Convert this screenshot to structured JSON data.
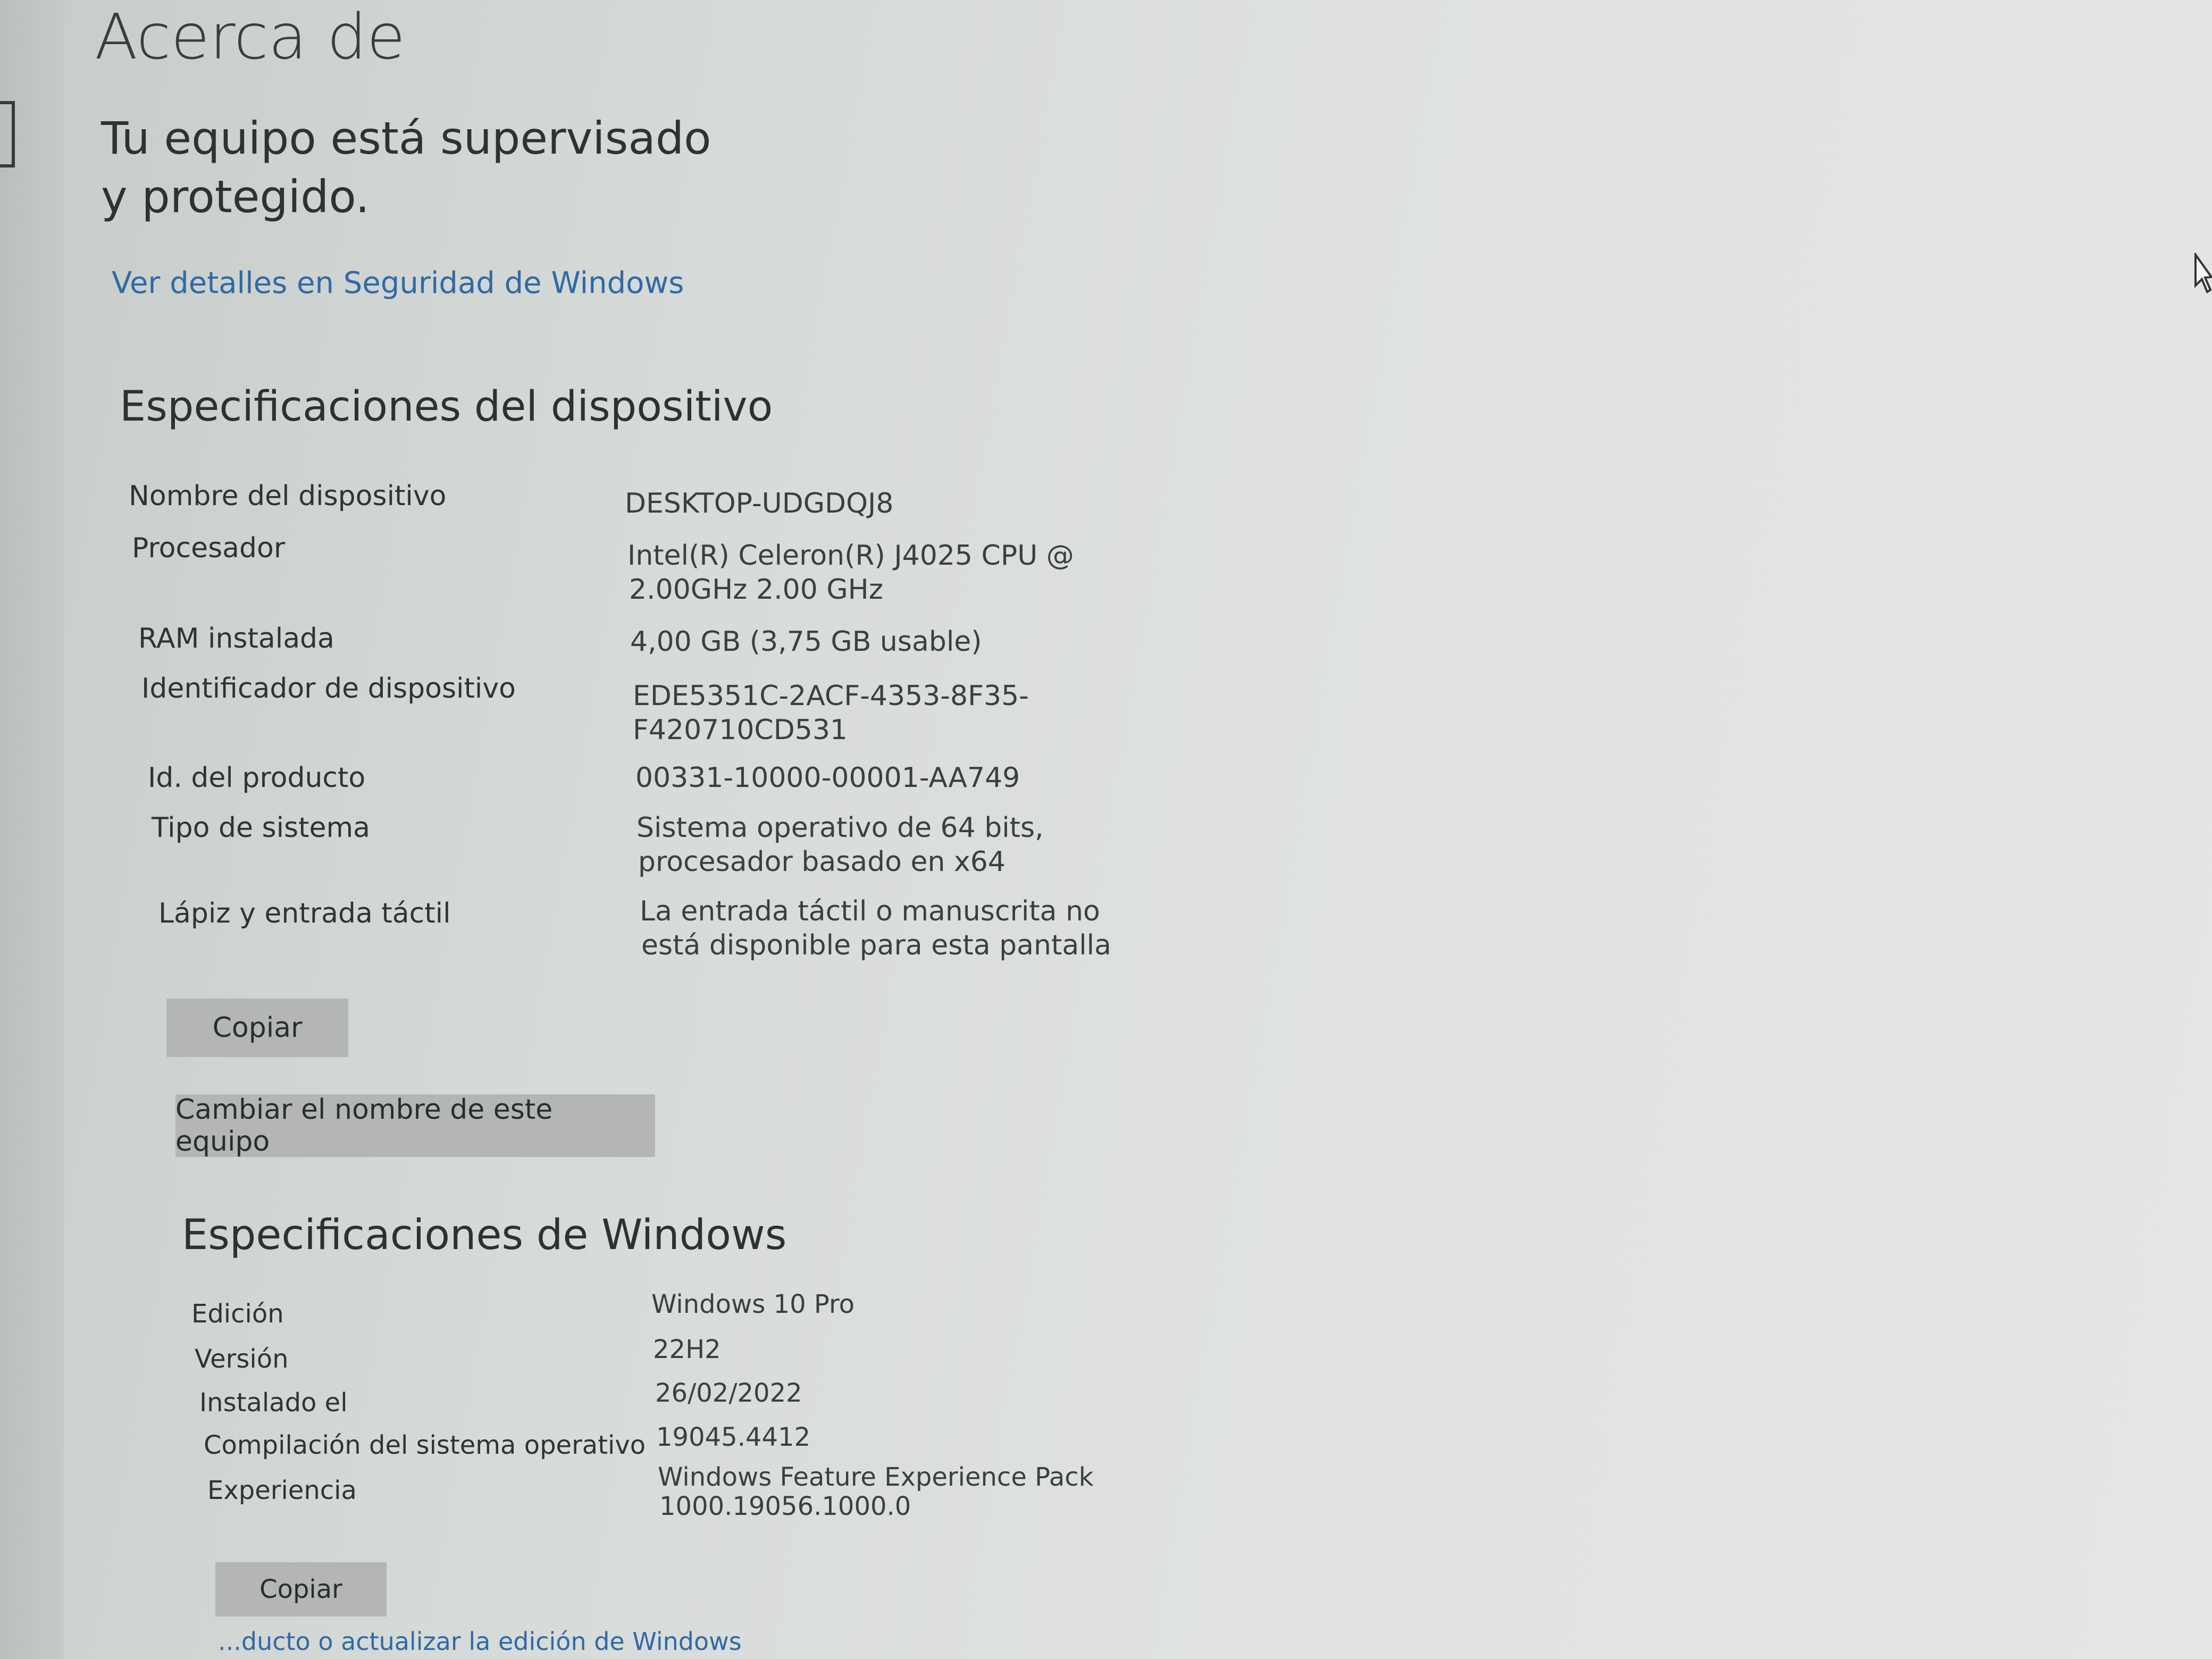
{
  "page": {
    "title": "Acerca de",
    "protection_status": "Tu equipo está supervisado y protegido.",
    "security_link": "Ver detalles en Seguridad de Windows"
  },
  "device_specs": {
    "heading": "Especificaciones del dispositivo",
    "rows": [
      {
        "label": "Nombre del dispositivo",
        "value": "DESKTOP-UDGDQJ8"
      },
      {
        "label": "Procesador",
        "value": "Intel(R) Celeron(R) J4025 CPU @",
        "value2": "2.00GHz   2.00 GHz"
      },
      {
        "label": "RAM instalada",
        "value": "4,00 GB (3,75 GB usable)"
      },
      {
        "label": "Identificador de dispositivo",
        "value": "EDE5351C-2ACF-4353-8F35-",
        "value2": "F420710CD531"
      },
      {
        "label": "Id. del producto",
        "value": "00331-10000-00001-AA749"
      },
      {
        "label": "Tipo de sistema",
        "value": "Sistema operativo de 64 bits,",
        "value2": "procesador basado en x64"
      },
      {
        "label": "Lápiz y entrada táctil",
        "value": "La entrada táctil o manuscrita no",
        "value2": "está disponible para esta pantalla"
      }
    ],
    "copy_button": "Copiar",
    "rename_button": "Cambiar el nombre de este equipo"
  },
  "windows_specs": {
    "heading": "Especificaciones de Windows",
    "rows": [
      {
        "label": "Edición",
        "value": "Windows 10 Pro"
      },
      {
        "label": "Versión",
        "value": "22H2"
      },
      {
        "label": "Instalado el",
        "value": "26/02/2022"
      },
      {
        "label": "Compilación del sistema operativo",
        "value": "19045.4412"
      },
      {
        "label": "Experiencia",
        "value": "Windows Feature Experience Pack",
        "value2": "1000.19056.1000.0"
      }
    ],
    "copy_button": "Copiar",
    "footer_link": "...ducto o actualizar la edición de Windows"
  },
  "icons": {
    "cursor": "mouse-pointer-icon"
  }
}
